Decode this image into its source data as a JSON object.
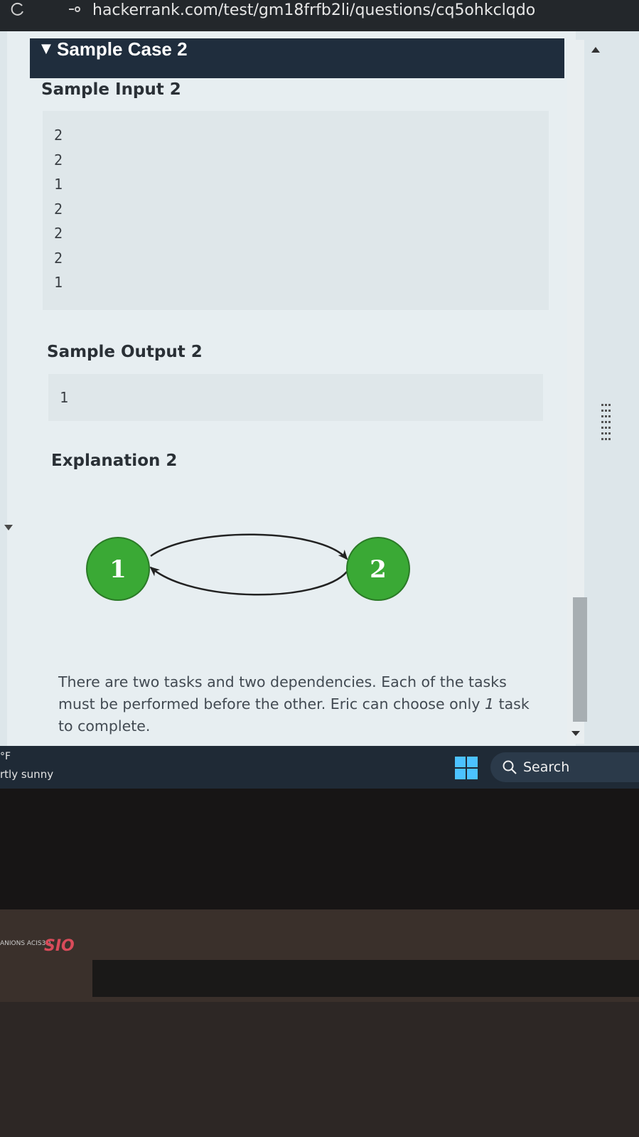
{
  "browser": {
    "url": "hackerrank.com/test/gm18frfb2li/questions/cq5ohkclqdo"
  },
  "sample_case": {
    "header": "Sample Case 2",
    "input_label": "Sample Input 2",
    "input_lines": [
      "2",
      "2",
      "1",
      "2",
      "2",
      "2",
      "1"
    ],
    "output_label": "Sample Output 2",
    "output_lines": [
      "1"
    ],
    "explanation_label": "Explanation 2",
    "graph": {
      "nodes": [
        "1",
        "2"
      ],
      "node_color": "#3aa935",
      "edges": [
        {
          "from": "1",
          "to": "2"
        },
        {
          "from": "2",
          "to": "1"
        }
      ]
    },
    "explanation_text_before": "There are two tasks and two dependencies. Each of the tasks must be performed before the other. Eric can choose only ",
    "explanation_italic": "1",
    "explanation_text_after": " task to complete."
  },
  "taskbar": {
    "weather_temp": "°F",
    "weather_condition": "rtly sunny",
    "search_label": "Search"
  },
  "laptop": {
    "brand_small": "ANIONS ACIS3O",
    "brand_logo": "SIO"
  }
}
